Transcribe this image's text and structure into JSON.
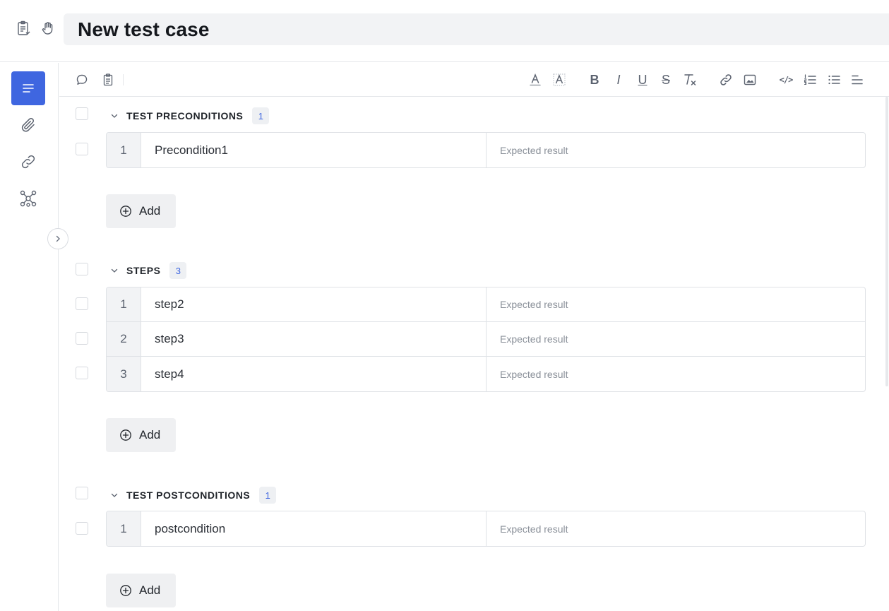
{
  "header": {
    "title": "New test case",
    "icons": [
      "clipboard-list-icon",
      "hand-icon"
    ]
  },
  "rail": {
    "items": [
      {
        "icon": "list-icon",
        "active": true
      },
      {
        "icon": "paperclip-icon",
        "active": false
      },
      {
        "icon": "link-icon",
        "active": false
      },
      {
        "icon": "network-icon",
        "active": false
      }
    ],
    "collapse_icon": "chevron-right-icon"
  },
  "toolbar": {
    "left": [
      "comment-icon",
      "clipboard-icon"
    ],
    "format": [
      "text-color-icon",
      "highlight-icon",
      "bold-icon",
      "italic-icon",
      "underline-icon",
      "strikethrough-icon",
      "clear-format-icon",
      "link-icon",
      "image-icon",
      "code-icon",
      "ordered-list-icon",
      "bullet-list-icon",
      "align-icon"
    ],
    "bold": "B",
    "italic": "I",
    "underline": "U",
    "strike": "S",
    "code": "</>"
  },
  "accent_color": "#3f66e0",
  "sections": {
    "preconditions": {
      "title": "TEST PRECONDITIONS",
      "count": "1",
      "rows": [
        {
          "num": "1",
          "step": "Precondition1",
          "expected": "Expected result"
        }
      ],
      "add_label": "Add"
    },
    "steps": {
      "title": "STEPS",
      "count": "3",
      "rows": [
        {
          "num": "1",
          "step": "step2",
          "expected": "Expected result"
        },
        {
          "num": "2",
          "step": "step3",
          "expected": "Expected result"
        },
        {
          "num": "3",
          "step": "step4",
          "expected": "Expected result"
        }
      ],
      "add_label": "Add"
    },
    "postconditions": {
      "title": "TEST POSTCONDITIONS",
      "count": "1",
      "rows": [
        {
          "num": "1",
          "step": "postcondition",
          "expected": "Expected result"
        }
      ],
      "add_label": "Add"
    }
  }
}
